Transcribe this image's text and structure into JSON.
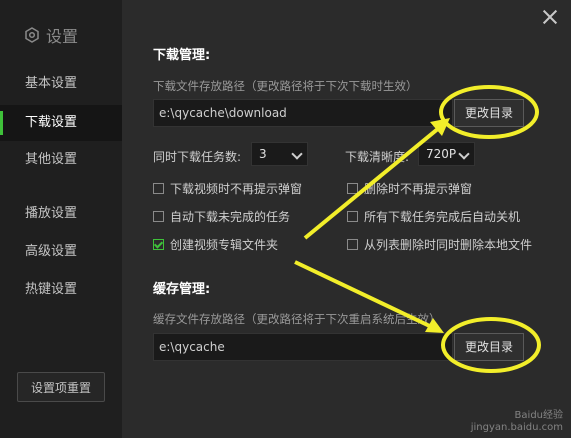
{
  "sidebar": {
    "title": "设置",
    "items": [
      {
        "label": "基本设置"
      },
      {
        "label": "下载设置"
      },
      {
        "label": "其他设置"
      },
      {
        "label": "播放设置"
      },
      {
        "label": "高级设置"
      },
      {
        "label": "热键设置"
      }
    ],
    "reset_label": "设置项重置"
  },
  "download": {
    "title": "下载管理:",
    "path_hint": "下载文件存放路径（更改路径将于下次下载时生效）",
    "path_value": "e:\\qycache\\download",
    "change_dir_label": "更改目录",
    "tasks_label": "同时下载任务数:",
    "tasks_value": "3",
    "quality_label": "下载清晰度:",
    "quality_value": "720P",
    "options": [
      {
        "label": "下载视频时不再提示弹窗",
        "checked": false
      },
      {
        "label": "删除时不再提示弹窗",
        "checked": false
      },
      {
        "label": "自动下载未完成的任务",
        "checked": false
      },
      {
        "label": "所有下载任务完成后自动关机",
        "checked": false
      },
      {
        "label": "创建视频专辑文件夹",
        "checked": true
      },
      {
        "label": "从列表删除时同时删除本地文件",
        "checked": false
      }
    ]
  },
  "cache": {
    "title": "缓存管理:",
    "path_hint": "缓存文件存放路径（更改路径将于下次重启系统后生效）",
    "path_value": "e:\\qycache",
    "change_dir_label": "更改目录"
  },
  "watermark": {
    "brand": "Baidu经验",
    "url": "jingyan.baidu.com"
  },
  "colors": {
    "accent": "#3fc13a",
    "annotation": "#f2ee2a"
  }
}
